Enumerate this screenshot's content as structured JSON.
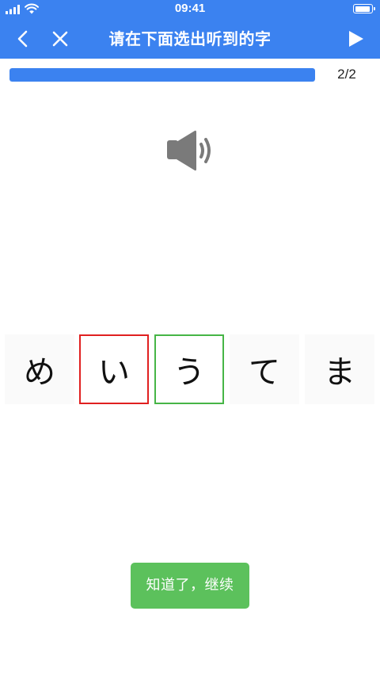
{
  "status_bar": {
    "time": "09:41"
  },
  "nav": {
    "title": "请在下面选出听到的字",
    "back_icon": "chevron-left-icon",
    "close_icon": "close-icon",
    "play_icon": "play-icon"
  },
  "progress": {
    "text": "2/2",
    "fraction": 1.0
  },
  "audio": {
    "icon": "speaker-icon"
  },
  "choices": [
    {
      "char": "め",
      "state": "default"
    },
    {
      "char": "い",
      "state": "wrong"
    },
    {
      "char": "う",
      "state": "correct"
    },
    {
      "char": "て",
      "state": "default"
    },
    {
      "char": "ま",
      "state": "default"
    }
  ],
  "continue_button": {
    "label": "知道了，继续"
  },
  "colors": {
    "primary": "#3b82f0",
    "wrong": "#e02020",
    "correct": "#46b546",
    "button": "#5cc15c"
  }
}
